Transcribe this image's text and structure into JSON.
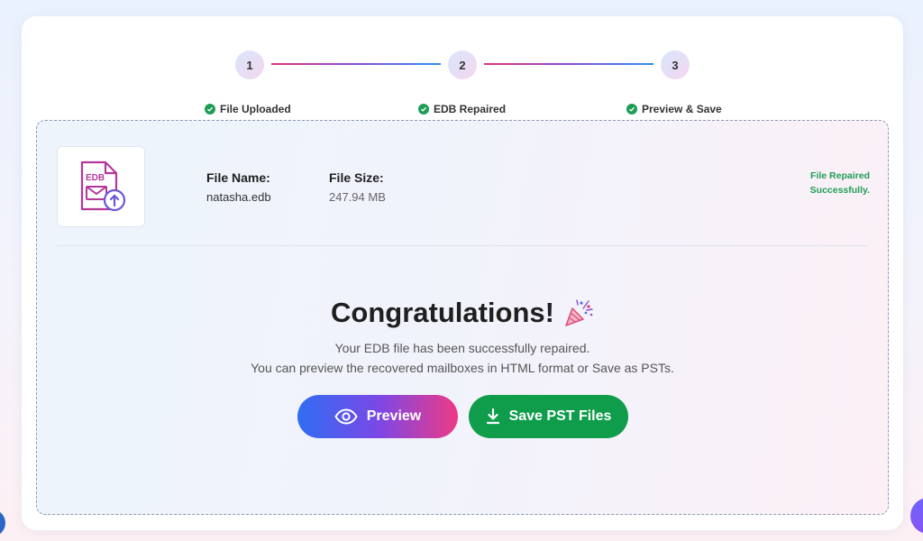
{
  "stepper": {
    "steps": [
      {
        "number": "1",
        "label": "File Uploaded"
      },
      {
        "number": "2",
        "label": "EDB Repaired"
      },
      {
        "number": "3",
        "label": "Preview & Save"
      }
    ]
  },
  "file": {
    "icon_text": "EDB",
    "name_label": "File Name:",
    "name_value": "natasha.edb",
    "size_label": "File Size:",
    "size_value": "247.94 MB",
    "status_line1": "File Repaired",
    "status_line2": "Successfully."
  },
  "result": {
    "title": "Congratulations!",
    "line1": "Your EDB file has been successfully repaired.",
    "line2": "You can preview the recovered mailboxes in HTML format or Save as PSTs."
  },
  "actions": {
    "preview_label": "Preview",
    "save_label": "Save PST Files"
  },
  "colors": {
    "success": "#1f9d55",
    "save_button": "#0f9d4c",
    "preview_gradient_start": "#2f6df2",
    "preview_gradient_end": "#ee3a86"
  }
}
